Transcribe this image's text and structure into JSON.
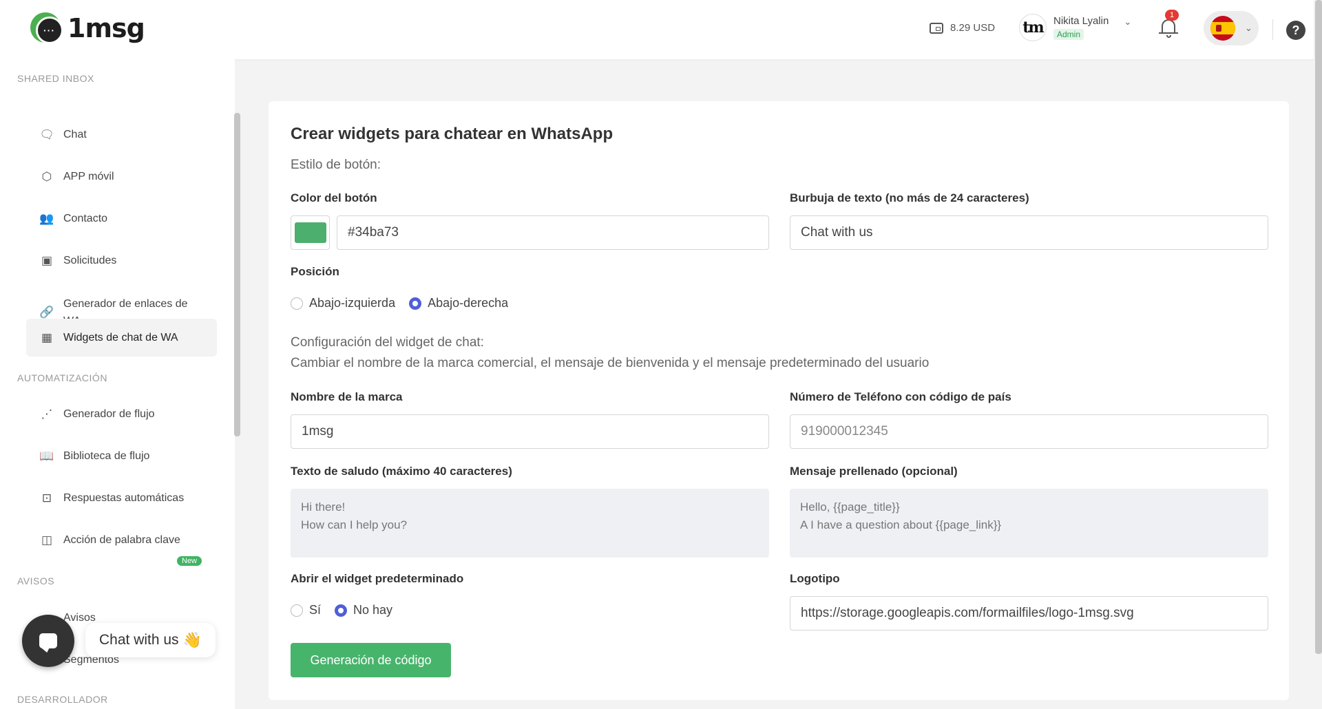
{
  "header": {
    "logo_text": "1msg",
    "balance": "8.29 USD",
    "user_name": "Nikita Lyalin",
    "user_role": "Admin",
    "avatar_text": "tm",
    "notifications_count": "1",
    "language": "Spanish"
  },
  "sidebar": {
    "sections": {
      "shared_inbox": "SHARED INBOX",
      "automation": "AUTOMATIZACIÓN",
      "notices": "AVISOS",
      "developer": "DESARROLLADOR"
    },
    "items": [
      {
        "label": "Chat",
        "icon": "chat-icon"
      },
      {
        "label": "APP móvil",
        "icon": "mobile-app-icon"
      },
      {
        "label": "Contacto",
        "icon": "contacts-icon"
      },
      {
        "label": "Solicitudes",
        "icon": "requests-icon"
      },
      {
        "label": "Generador de enlaces de WA",
        "icon": "link-icon"
      },
      {
        "label": "Widgets de chat de WA",
        "icon": "widgets-icon",
        "active": true
      },
      {
        "label": "Generador de flujo",
        "icon": "flow-icon"
      },
      {
        "label": "Biblioteca de flujo",
        "icon": "library-icon"
      },
      {
        "label": "Respuestas automáticas",
        "icon": "auto-reply-icon"
      },
      {
        "label": "Acción de palabra clave",
        "icon": "keyword-icon"
      },
      {
        "label": "Avisos",
        "icon": "notice-icon",
        "badge": "New"
      },
      {
        "label": "Segmentos",
        "icon": "segments-icon"
      }
    ]
  },
  "chat_widget": {
    "text": "Chat with us",
    "emoji": "👋"
  },
  "form": {
    "title": "Crear widgets para chatear en WhatsApp",
    "button_style_label": "Estilo de botón:",
    "button_color_label": "Color del botón",
    "button_color_value": "#34ba73",
    "bubble_text_label": "Burbuja de texto (no más de 24 caracteres)",
    "bubble_text_value": "Chat with us",
    "position_label": "Posición",
    "position_options": [
      "Abajo-izquierda",
      "Abajo-derecha"
    ],
    "position_selected": "Abajo-derecha",
    "widget_config_title": "Configuración del widget de chat:",
    "widget_config_desc": "Cambiar el nombre de la marca comercial, el mensaje de bienvenida y el mensaje predeterminado del usuario",
    "brand_name_label": "Nombre de la marca",
    "brand_name_value": "1msg",
    "phone_label": "Número de Teléfono con código de país",
    "phone_placeholder": "919000012345",
    "greeting_label": "Texto de saludo (máximo 40 caracteres)",
    "greeting_lines": [
      "Hi there!",
      "How can I help you?"
    ],
    "prefilled_label": "Mensaje prellenado (opcional)",
    "prefilled_lines": [
      "Hello, {{page_title}}",
      "A I have a question about {{page_link}}"
    ],
    "open_default_label": "Abrir el widget predeterminado",
    "open_default_options": [
      "Sí",
      "No hay"
    ],
    "open_default_selected": "No hay",
    "logo_label": "Logotipo",
    "logo_value": "https://storage.googleapis.com/formailfiles/logo-1msg.svg",
    "generate_button": "Generación de código"
  },
  "colors": {
    "accent_green": "#47b46c",
    "radio_blue": "#4e5fd8",
    "swatch": "#34ba73"
  }
}
